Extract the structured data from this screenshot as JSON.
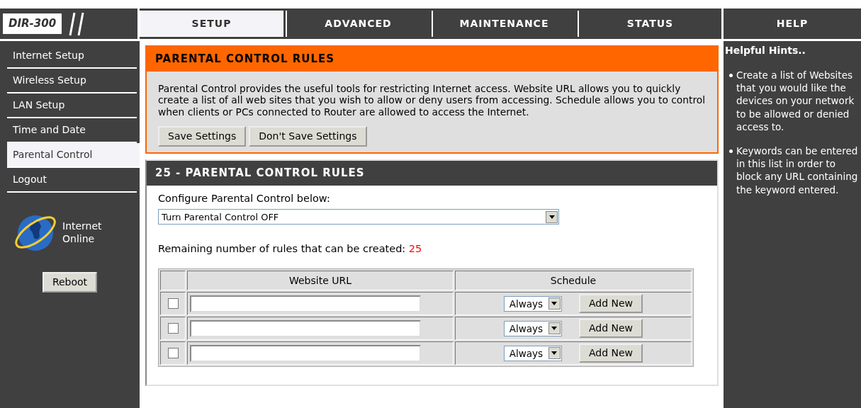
{
  "logo": {
    "text": "DIR-300"
  },
  "tabs": [
    {
      "label": "SETUP",
      "selected": true
    },
    {
      "label": "ADVANCED",
      "selected": false
    },
    {
      "label": "MAINTENANCE",
      "selected": false
    },
    {
      "label": "STATUS",
      "selected": false
    },
    {
      "label": "HELP",
      "selected": false
    }
  ],
  "sidebar": {
    "items": [
      {
        "label": "Internet Setup",
        "selected": false
      },
      {
        "label": "Wireless Setup",
        "selected": false
      },
      {
        "label": "LAN Setup",
        "selected": false
      },
      {
        "label": "Time and Date",
        "selected": false
      },
      {
        "label": "Parental Control",
        "selected": true
      },
      {
        "label": "Logout",
        "selected": false
      }
    ],
    "internet_status": "Internet Online",
    "reboot_button": "Reboot"
  },
  "intro": {
    "title": "PARENTAL CONTROL RULES",
    "text": "Parental Control provides the useful tools for restricting Internet access. Website URL allows you to quickly create a list of all web sites that you wish to allow or deny users from accessing. Schedule allows you to control when clients or PCs connected to Router are allowed to access the Internet.",
    "buttons": [
      "Save Settings",
      "Don't Save Settings"
    ]
  },
  "rules": {
    "title": "25 - PARENTAL CONTROL RULES",
    "configure_label": "Configure Parental Control below:",
    "configure_value": "Turn Parental Control OFF",
    "remaining_label": "Remaining number of rules that can be created:",
    "remaining_count": "25",
    "table": {
      "columns": [
        "Website URL",
        "Schedule"
      ],
      "rows": [
        {
          "checked": false,
          "url": "",
          "schedule": "Always",
          "button": "Add New"
        },
        {
          "checked": false,
          "url": "",
          "schedule": "Always",
          "button": "Add New"
        },
        {
          "checked": false,
          "url": "",
          "schedule": "Always",
          "button": "Add New"
        }
      ]
    }
  },
  "hints": {
    "title": "Helpful Hints..",
    "items": [
      "Create a list of Websites that you would like the devices on your network to be allowed or denied access to.",
      "Keywords can be entered in this list in order to block any URL containing the keyword entered."
    ]
  }
}
